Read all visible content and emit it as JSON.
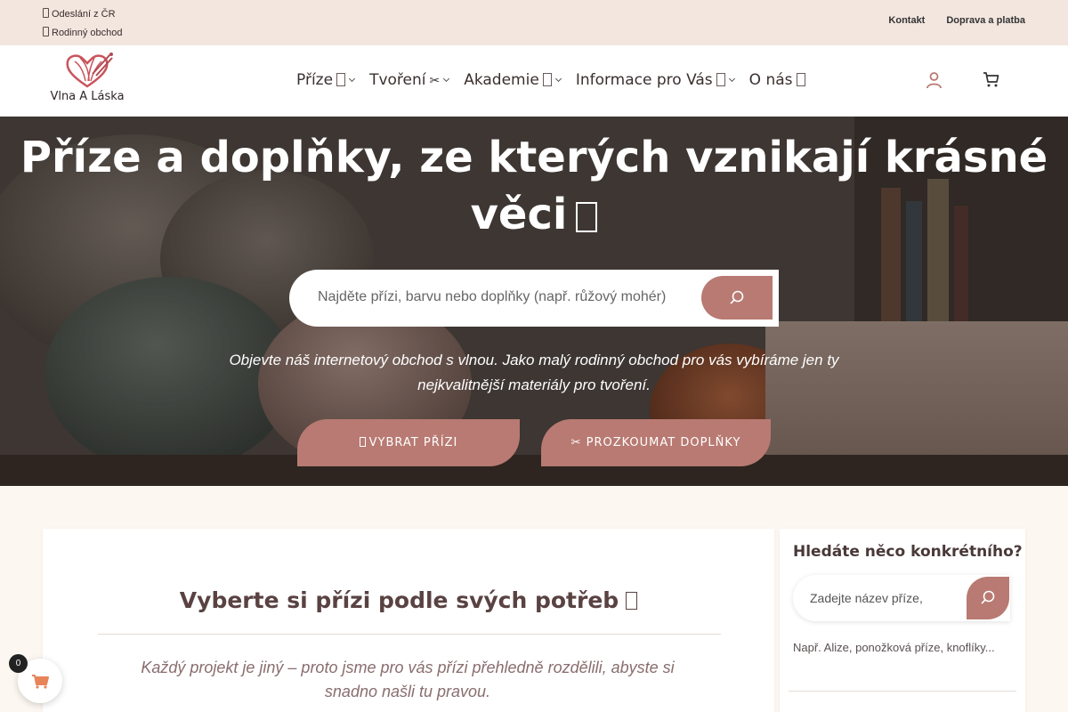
{
  "topbar": {
    "info": [
      "Odeslání z ČR",
      "Rodinný obchod"
    ],
    "links": [
      "Kontakt",
      "Doprava a platba"
    ]
  },
  "header": {
    "brand": "Vlna A Láska",
    "nav": [
      {
        "label": "Příze",
        "icon": "emoji-placeholder",
        "has_dropdown": true
      },
      {
        "label": "Tvoření",
        "icon": "✂",
        "has_dropdown": true
      },
      {
        "label": "Akademie",
        "icon": "emoji-placeholder",
        "has_dropdown": true
      },
      {
        "label": "Informace pro Vás",
        "icon": "emoji-placeholder",
        "has_dropdown": true
      },
      {
        "label": "O nás",
        "icon": "emoji-placeholder",
        "has_dropdown": false
      }
    ],
    "icons": [
      "account-icon",
      "cart-icon"
    ]
  },
  "hero": {
    "title": "Příze a doplňky, ze kterých vznikají krásné věci",
    "search_placeholder": "Najděte přízi, barvu nebo doplňky (např. růžový mohér)",
    "description": "Objevte náš internetový obchod s vlnou. Jako malý rodinný obchod pro vás vybíráme jen ty nejkvalitnější materiály pro tvoření.",
    "cta_primary": "VYBRAT PŘÍZI",
    "cta_secondary": "✂ PROZKOUMAT DOPLŇKY"
  },
  "main": {
    "heading": "Vyberte si přízi podle svých potřeb",
    "subtitle": "Každý projekt je jiný – proto jsme pro vás přízi přehledně rozdělili, abyste si snadno našli tu pravou."
  },
  "sidebar": {
    "heading": "Hledáte něco konkrétního?",
    "search_placeholder": "Zadejte název příze,",
    "hint": "Např. Alize, ponožková příze, knoflíky..."
  },
  "cart": {
    "count": "0"
  },
  "colors": {
    "accent": "#b87a72",
    "topbar_bg": "#f2e6df",
    "page_bg": "#fcf7f1"
  }
}
